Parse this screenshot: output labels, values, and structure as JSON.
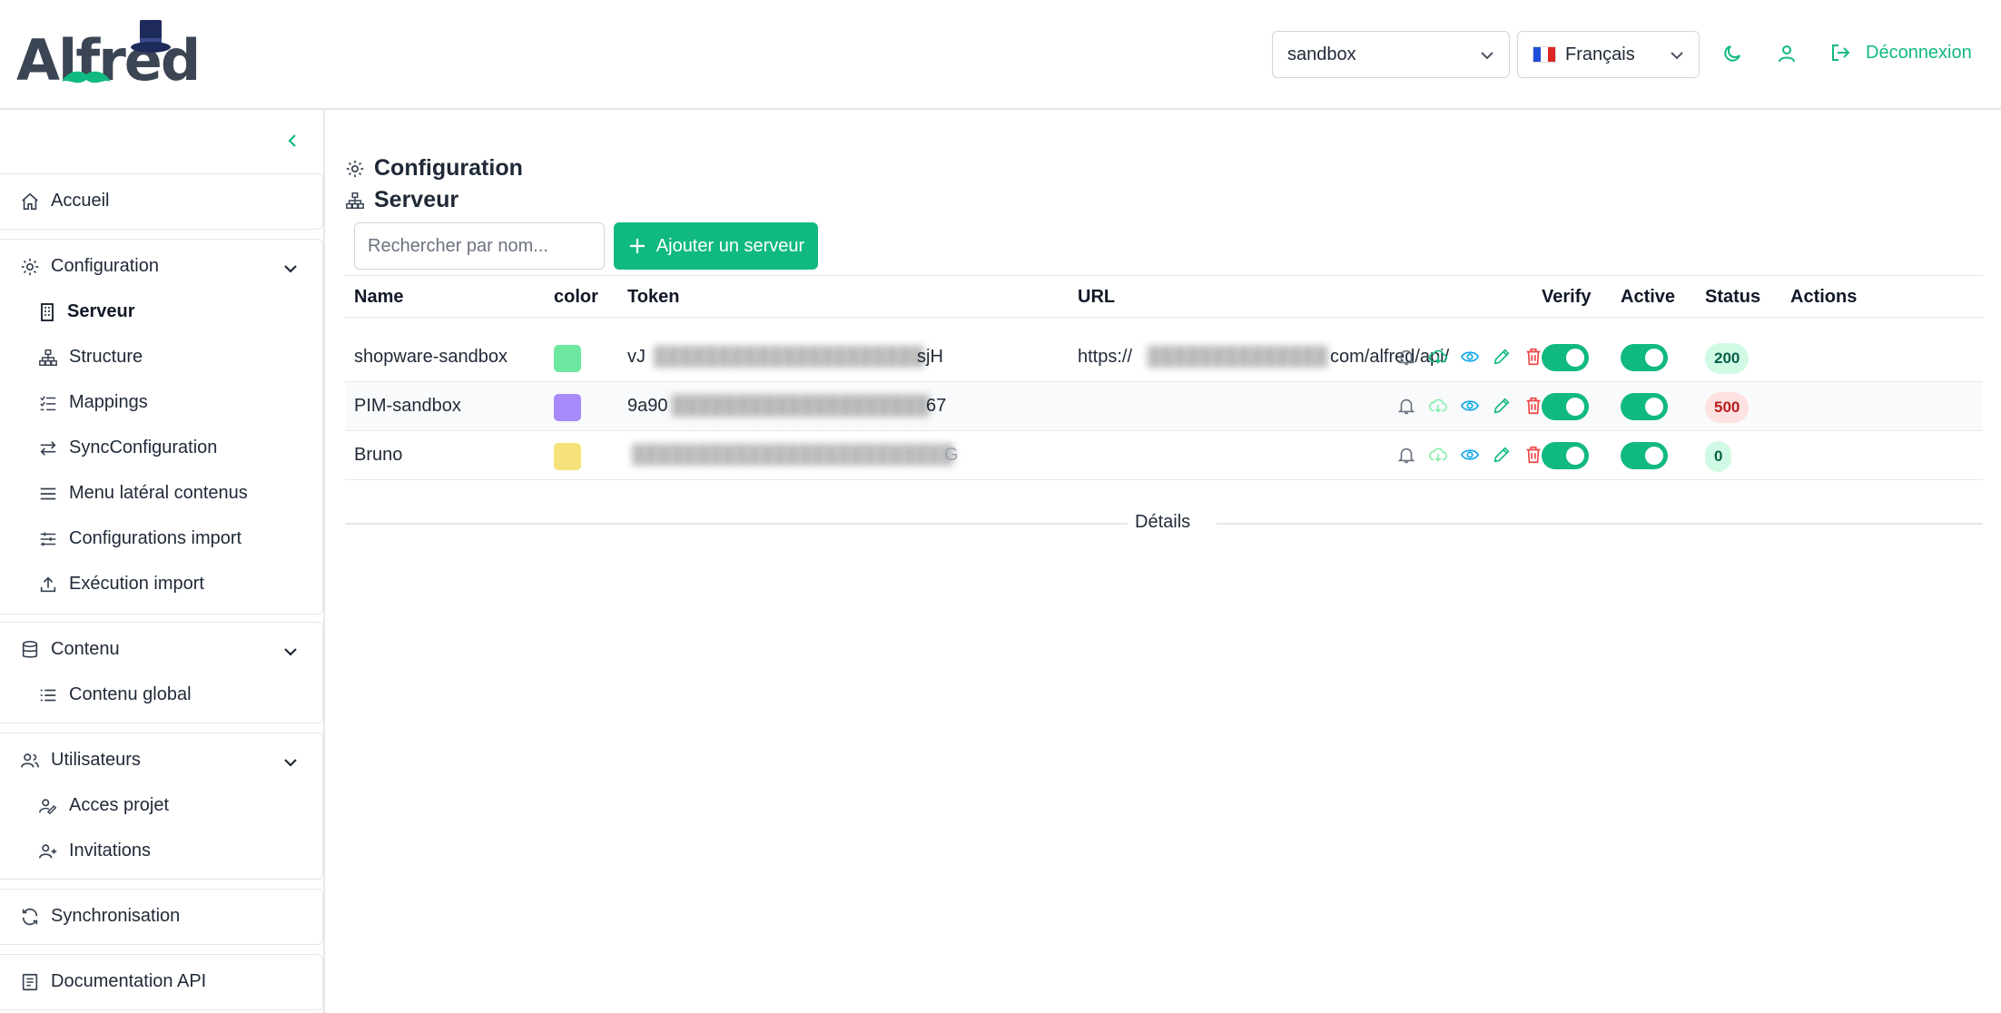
{
  "header": {
    "logo_text": "Alfred",
    "project_select": "sandbox",
    "language_select": "Français",
    "logout_label": "Déconnexion"
  },
  "sidebar": {
    "home": "Accueil",
    "configuration": {
      "label": "Configuration",
      "items": [
        "Serveur",
        "Structure",
        "Mappings",
        "SyncConfiguration",
        "Menu latéral contenus",
        "Configurations import",
        "Exécution import"
      ]
    },
    "contenu": {
      "label": "Contenu",
      "items": [
        "Contenu global"
      ]
    },
    "utilisateurs": {
      "label": "Utilisateurs",
      "items": [
        "Acces projet",
        "Invitations"
      ]
    },
    "synchronisation": "Synchronisation",
    "documentation": "Documentation API"
  },
  "main": {
    "breadcrumb": [
      "Configuration",
      "Serveur"
    ],
    "search_placeholder": "Rechercher par nom...",
    "add_button": "Ajouter un serveur",
    "columns": [
      "Name",
      "color",
      "Token",
      "URL",
      "Verify",
      "Active",
      "Status",
      "Actions"
    ],
    "rows": [
      {
        "name": "shopware-sandbox",
        "color": "#6ee7a0",
        "token_start": "vJ",
        "token_end": "sjH",
        "url_start": "https://",
        "url_end": "com/alfred/api/",
        "verify": true,
        "active": true,
        "status": "200"
      },
      {
        "name": "PIM-sandbox",
        "color": "#a78bfa",
        "token_start": "9a90",
        "token_end": "67",
        "url_start": "",
        "url_end": "",
        "verify": true,
        "active": true,
        "status": "500"
      },
      {
        "name": "Bruno",
        "color": "#f6e27a",
        "token_start": "",
        "token_end": "G",
        "url_start": "",
        "url_end": "",
        "verify": true,
        "active": true,
        "status": "0"
      }
    ],
    "details_label": "Détails"
  },
  "colors": {
    "accent": "#10b981",
    "status_ok_bg": "#d1fae5",
    "status_ok_fg": "#065f46",
    "status_err_bg": "#fee2e2",
    "status_err_fg": "#b91c1c",
    "action_delete": "#ef4444",
    "action_view": "#0ea5e9"
  }
}
